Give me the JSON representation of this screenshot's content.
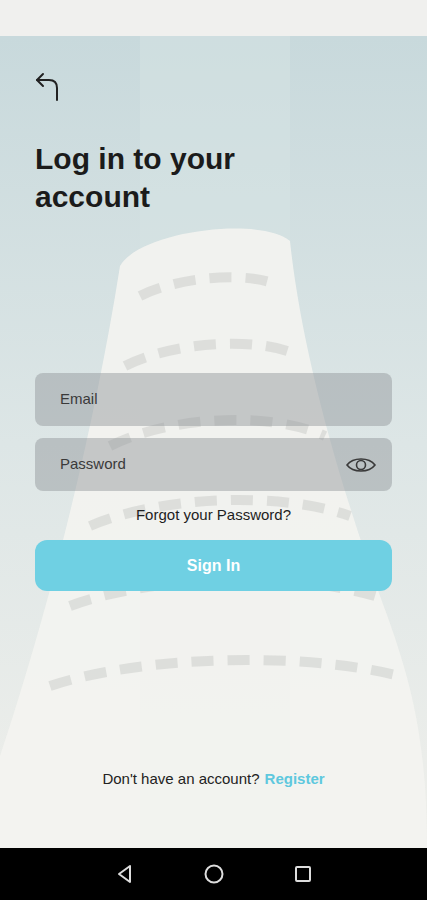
{
  "screen": {
    "title": "Log in to your account"
  },
  "form": {
    "email_placeholder": "Email",
    "password_placeholder": "Password",
    "forgot": "Forgot your Password?",
    "submit": "Sign In"
  },
  "footer": {
    "prompt": "Don't have an account?",
    "link": "Register"
  }
}
